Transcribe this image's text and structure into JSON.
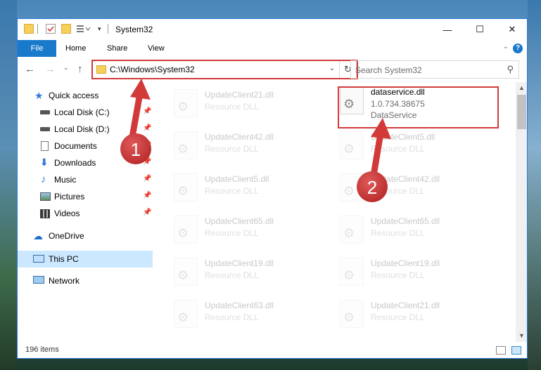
{
  "window": {
    "title": "System32",
    "minimize_glyph": "—",
    "maximize_glyph": "☐",
    "close_glyph": "✕"
  },
  "ribbon": {
    "tabs": [
      "File",
      "Home",
      "Share",
      "View"
    ],
    "help_glyph": "?"
  },
  "address": {
    "path": "C:\\Windows\\System32",
    "refresh_glyph": "↻"
  },
  "search": {
    "placeholder": "Search System32"
  },
  "nav": {
    "items": [
      {
        "label": "Quick access",
        "icon": "star-icon"
      },
      {
        "label": "Local Disk (C:)",
        "icon": "drive-icon"
      },
      {
        "label": "Local Disk (D:)",
        "icon": "drive-icon"
      },
      {
        "label": "Documents",
        "icon": "documents-icon"
      },
      {
        "label": "Downloads",
        "icon": "download-icon"
      },
      {
        "label": "Music",
        "icon": "music-icon"
      },
      {
        "label": "Pictures",
        "icon": "pictures-icon"
      },
      {
        "label": "Videos",
        "icon": "videos-icon"
      },
      {
        "label": "OneDrive",
        "icon": "cloud-icon"
      },
      {
        "label": "This PC",
        "icon": "computer-icon"
      },
      {
        "label": "Network",
        "icon": "network-icon"
      }
    ]
  },
  "files": {
    "highlighted": {
      "name": "dataservice.dll",
      "version": "1.0.734.38675",
      "description": "DataService"
    },
    "left_column": [
      {
        "name": "UpdateClient21.dll",
        "type": "Resource DLL"
      },
      {
        "name": "UpdateClient42.dll",
        "type": "Resource DLL"
      },
      {
        "name": "UpdateClient5.dll",
        "type": "Resource DLL"
      },
      {
        "name": "UpdateClient65.dll",
        "type": "Resource DLL"
      },
      {
        "name": "UpdateClient19.dll",
        "type": "Resource DLL"
      },
      {
        "name": "UpdateClient63.dll",
        "type": "Resource DLL"
      }
    ],
    "right_column": [
      {
        "name": "UpdateClient5.dll",
        "type": "Resource DLL"
      },
      {
        "name": "UpdateClient42.dll",
        "type": "Resource DLL"
      },
      {
        "name": "UpdateClient65.dll",
        "type": "Resource DLL"
      },
      {
        "name": "UpdateClient19.dll",
        "type": "Resource DLL"
      },
      {
        "name": "UpdateClient21.dll",
        "type": "Resource DLL"
      }
    ]
  },
  "status": {
    "item_count": "196 items"
  },
  "annotations": {
    "step1": "1",
    "step2": "2",
    "color": "#d23a3a"
  }
}
